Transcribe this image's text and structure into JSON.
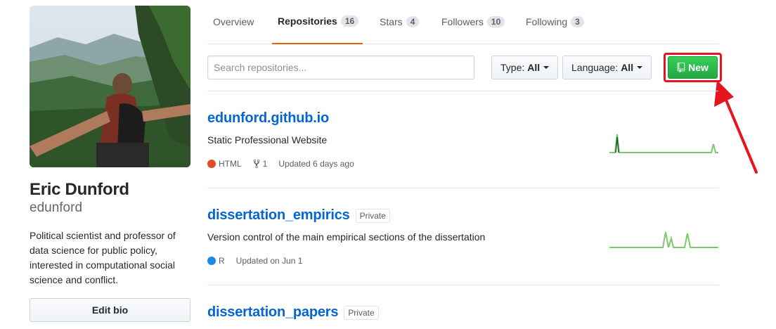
{
  "profile": {
    "name": "Eric Dunford",
    "login": "edunford",
    "bio": "Political scientist and professor of data science for public policy, interested in computational social science and conflict.",
    "edit_bio_label": "Edit bio"
  },
  "tabs": [
    {
      "label": "Overview",
      "count": null
    },
    {
      "label": "Repositories",
      "count": "16"
    },
    {
      "label": "Stars",
      "count": "4"
    },
    {
      "label": "Followers",
      "count": "10"
    },
    {
      "label": "Following",
      "count": "3"
    }
  ],
  "filters": {
    "search_placeholder": "Search repositories...",
    "type_label": "Type:",
    "type_value": "All",
    "language_label": "Language:",
    "language_value": "All",
    "new_label": "New"
  },
  "repos": [
    {
      "name": "edunford.github.io",
      "private_label": null,
      "description": "Static Professional Website",
      "language": "HTML",
      "language_color": "#e34c26",
      "forks": "1",
      "updated": "Updated 6 days ago"
    },
    {
      "name": "dissertation_empirics",
      "private_label": "Private",
      "description": "Version control of the main empirical sections of the dissertation",
      "language": "R",
      "language_color": "#198ce7",
      "forks": null,
      "updated": "Updated on Jun 1"
    },
    {
      "name": "dissertation_papers",
      "private_label": "Private"
    }
  ],
  "colors": {
    "link": "#0366d6",
    "new_button": "#28a745",
    "highlight": "#e5141f",
    "selected_tab_border": "#e36209"
  }
}
